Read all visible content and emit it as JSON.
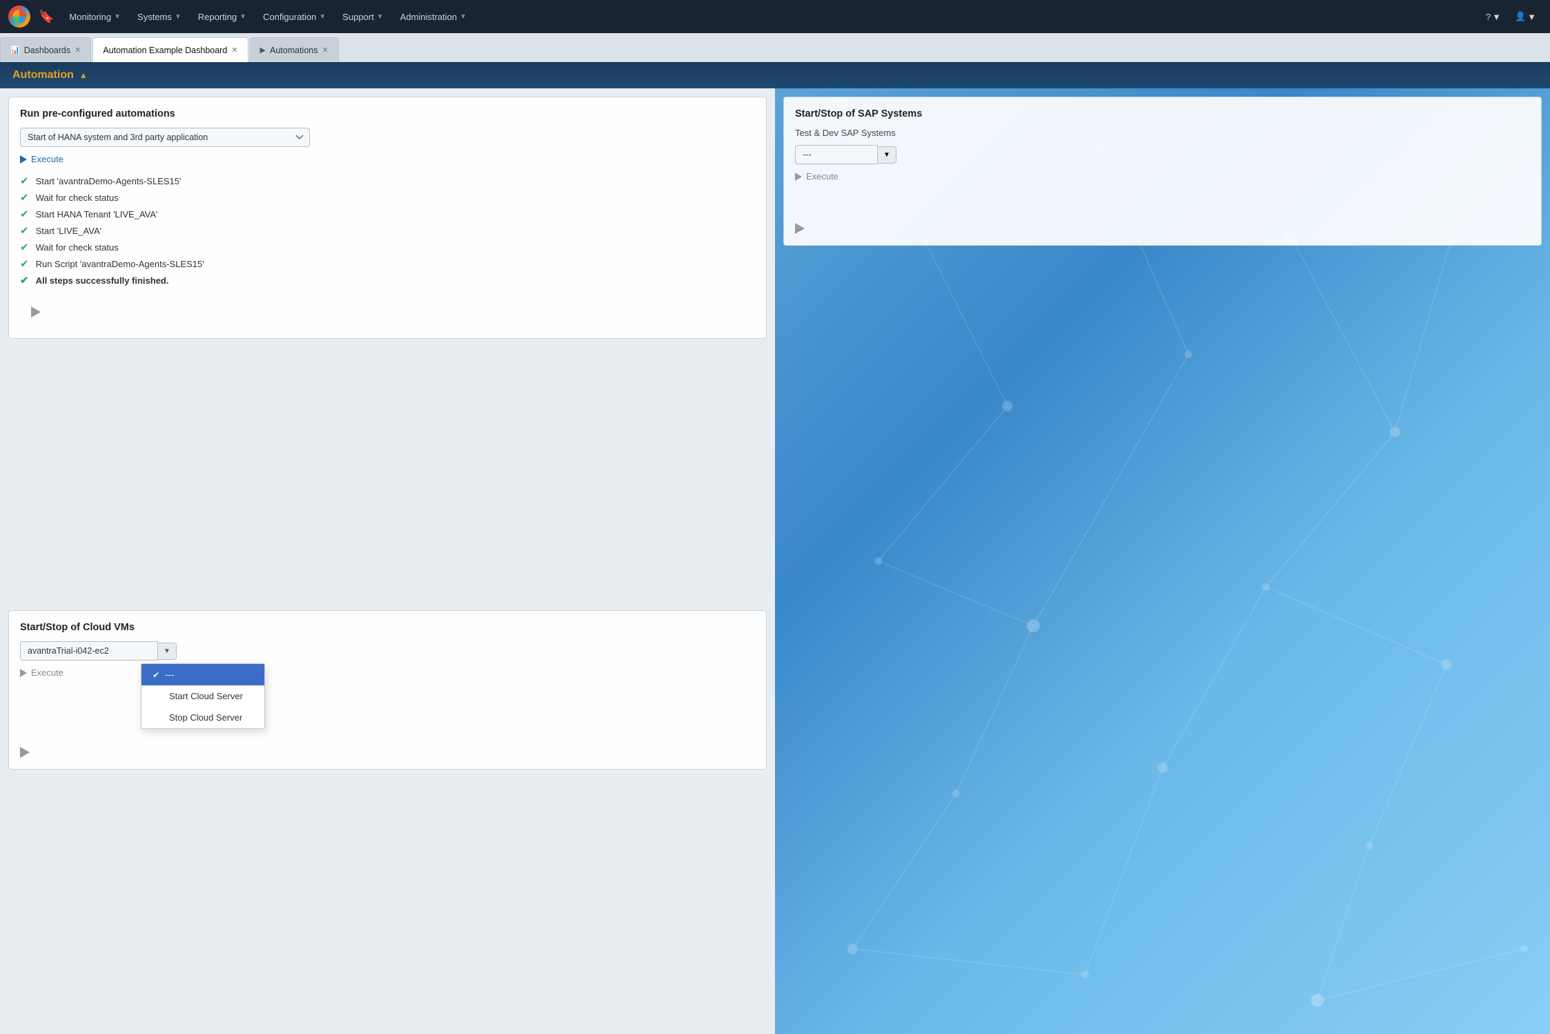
{
  "app": {
    "logo_alt": "App Logo"
  },
  "topnav": {
    "items": [
      {
        "id": "monitoring",
        "label": "Monitoring",
        "has_caret": true
      },
      {
        "id": "systems",
        "label": "Systems",
        "has_caret": true
      },
      {
        "id": "reporting",
        "label": "Reporting",
        "has_caret": true
      },
      {
        "id": "configuration",
        "label": "Configuration",
        "has_caret": true
      },
      {
        "id": "support",
        "label": "Support",
        "has_caret": true
      },
      {
        "id": "administration",
        "label": "Administration",
        "has_caret": true
      }
    ],
    "right_items": [
      {
        "id": "help",
        "icon": "?",
        "has_caret": true
      },
      {
        "id": "user",
        "icon": "👤",
        "has_caret": true
      }
    ]
  },
  "tabbar": {
    "tabs": [
      {
        "id": "dashboards",
        "label": "Dashboards",
        "active": false,
        "closable": true,
        "icon": "📊"
      },
      {
        "id": "automation-example",
        "label": "Automation Example Dashboard",
        "active": true,
        "closable": true,
        "icon": ""
      },
      {
        "id": "automations",
        "label": "Automations",
        "active": false,
        "closable": true,
        "icon": "▶"
      }
    ]
  },
  "section": {
    "title": "Automation",
    "caret": "▲"
  },
  "preconfigured_panel": {
    "title": "Run pre-configured automations",
    "select_value": "Start of HANA system and 3rd party application",
    "select_options": [
      "Start of HANA system and 3rd party application"
    ],
    "execute_label": "Execute",
    "steps": [
      {
        "id": 1,
        "text": "Start 'avantraDemo-Agents-SLES15'",
        "done": true,
        "bold": false
      },
      {
        "id": 2,
        "text": "Wait for check status",
        "done": true,
        "bold": false
      },
      {
        "id": 3,
        "text": "Start HANA Tenant 'LIVE_AVA'",
        "done": true,
        "bold": false
      },
      {
        "id": 4,
        "text": "Start 'LIVE_AVA'",
        "done": true,
        "bold": false
      },
      {
        "id": 5,
        "text": "Wait for check status",
        "done": true,
        "bold": false
      },
      {
        "id": 6,
        "text": "Run Script 'avantraDemo-Agents-SLES15'",
        "done": true,
        "bold": false
      },
      {
        "id": 7,
        "text": "All steps successfully finished.",
        "done": true,
        "bold": true
      }
    ]
  },
  "sap_panel": {
    "title": "Start/Stop of SAP Systems",
    "subtitle": "Test & Dev SAP Systems",
    "select_value": "---",
    "select_options": [
      "---"
    ],
    "execute_label": "Execute"
  },
  "cloud_panel": {
    "title": "Start/Stop of Cloud VMs",
    "select_main_value": "avantraTrial-i042-ec2",
    "select_main_options": [
      "avantraTrial-i042-ec2"
    ],
    "action_select_value": "---",
    "action_options": [
      {
        "id": "placeholder",
        "label": "---",
        "selected": true
      },
      {
        "id": "start",
        "label": "Start Cloud Server",
        "selected": false
      },
      {
        "id": "stop",
        "label": "Stop Cloud Server",
        "selected": false
      }
    ],
    "execute_label": "Execute"
  },
  "icons": {
    "play": "▶",
    "check": "✔",
    "chevron_down": "▼",
    "chevron_up": "▲",
    "bookmark": "🔖"
  },
  "colors": {
    "nav_bg": "#1a2332",
    "header_bg": "#1a3a5c",
    "header_text": "#e8a020",
    "check_green": "#27ae60",
    "selected_blue": "#3b6cc7",
    "card_bg": "rgba(255,255,255,0.92)"
  }
}
